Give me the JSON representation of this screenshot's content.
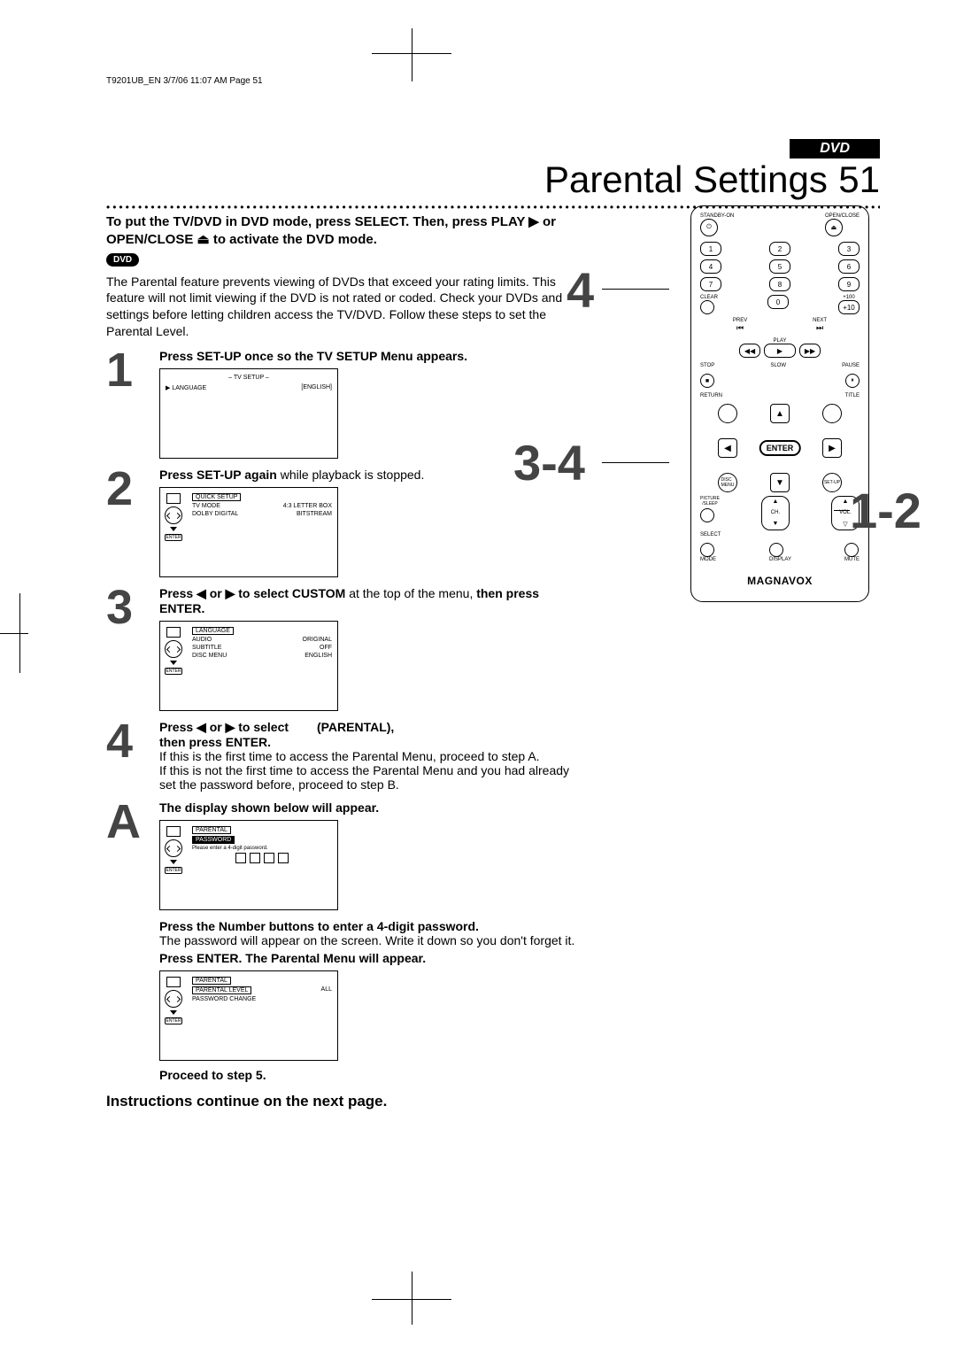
{
  "header": "T9201UB_EN  3/7/06  11:07 AM  Page 51",
  "section_tab": "DVD",
  "title": "Parental Settings",
  "page_num": "51",
  "intro_bold": "To put the TV/DVD in DVD mode, press SELECT. Then, press PLAY ▶ or OPEN/CLOSE ⏏ to activate the DVD mode.",
  "dvd_badge": "DVD",
  "body": "The Parental feature prevents viewing of DVDs that exceed your rating limits. This feature will not limit viewing if the DVD is not rated or coded.  Check your DVDs and settings before letting children access the TV/DVD. Follow these steps to set the Parental Level.",
  "steps": {
    "s1": {
      "num": "1",
      "bold": "Press SET-UP once so the TV SETUP Menu appears."
    },
    "s2": {
      "num": "2",
      "bold": "Press SET-UP again",
      "plain": " while playback is stopped."
    },
    "s3": {
      "num": "3",
      "bold1": "Press ◀ or ▶ to select CUSTOM",
      "plain": " at the top of the menu, ",
      "bold2": "then press ENTER."
    },
    "s4": {
      "num": "4",
      "line1_bold1": "Press ◀ or ▶ to select",
      "line1_label": "(PARENTAL),",
      "line2_bold": "then press ENTER.",
      "para1": "If this is the first time to access the Parental Menu, proceed to step A.",
      "para2": "If this is not the first time to access the Parental Menu and you had already set the password before, proceed to step B."
    },
    "sA": {
      "letter": "A",
      "line1_bold": "The display shown below will appear.",
      "line2_bold": "Press the Number buttons to enter a 4-digit password.",
      "line2_plain": "The password will appear on the screen. Write it down so you don't forget it.",
      "line3_bold": "Press ENTER. The Parental Menu will appear.",
      "proceed": "Proceed to step 5."
    }
  },
  "screens": {
    "s1": {
      "title": "– TV SETUP –",
      "row1a": "▶ LANGUAGE",
      "row1b": "[ENGLISH]"
    },
    "s2": {
      "tab": "QUICK SETUP",
      "r1a": "TV MODE",
      "r1b": "4:3 LETTER BOX",
      "r2a": "DOLBY DIGITAL",
      "r2b": "BITSTREAM"
    },
    "s3": {
      "tab": "LANGUAGE",
      "r1a": "AUDIO",
      "r1b": "ORIGINAL",
      "r2a": "SUBTITLE",
      "r2b": "OFF",
      "r3a": "DISC MENU",
      "r3b": "ENGLISH"
    },
    "sA": {
      "tab": "PARENTAL",
      "sel": "PASSWORD",
      "hint": "Please enter a 4-digit password."
    },
    "sA2": {
      "tab": "PARENTAL",
      "r1a": "PARENTAL LEVEL",
      "r1b": "ALL",
      "r2a": "PASSWORD CHANGE"
    }
  },
  "remote": {
    "standby": "STANDBY-ON",
    "open": "OPEN/CLOSE",
    "n1": "1",
    "n2": "2",
    "n3": "3",
    "n4": "4",
    "n5": "5",
    "n6": "6",
    "n7": "7",
    "n8": "8",
    "n9": "9",
    "n0": "0",
    "clear": "CLEAR",
    "plus100": "+100",
    "plus10": "+10",
    "prev": "PREV",
    "next": "NEXT",
    "play": "PLAY",
    "stop": "STOP",
    "slow": "SLOW",
    "pause": "PAUSE",
    "return": "RETURN",
    "title": "TITLE",
    "enter": "ENTER",
    "disc_menu": "DISC\nMENU",
    "setup": "SET-UP",
    "picsleep": "PICTURE\n/SLEEP",
    "ch": "CH.",
    "vol": "VOL.",
    "select": "SELECT",
    "mode": "MODE",
    "display": "DISPLAY",
    "mute": "MUTE",
    "brand": "MAGNAVOX"
  },
  "callouts": {
    "c1": "4",
    "c2": "3-4",
    "c3": "1-2"
  },
  "continue": "Instructions continue on the next page."
}
